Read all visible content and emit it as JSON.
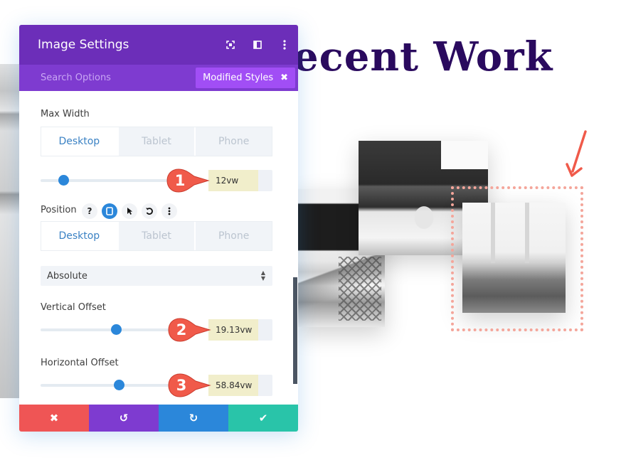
{
  "page": {
    "heading": "ecent Work"
  },
  "panel": {
    "title": "Image Settings",
    "header_icons": [
      "expand-icon",
      "split-view-icon",
      "more-options-icon"
    ],
    "search_placeholder": "Search Options",
    "filter_badge": "Modified Styles",
    "filter_badge_close": "✖",
    "max_width": {
      "label": "Max Width",
      "tabs": [
        "Desktop",
        "Tablet",
        "Phone"
      ],
      "active_tab": "Desktop",
      "value": "12vw",
      "slider_fraction": 0.16,
      "annotation": "1"
    },
    "position": {
      "label": "Position",
      "icons": [
        "help-icon",
        "responsive-icon",
        "hover-cursor-icon",
        "reset-icon",
        "more-options-icon"
      ],
      "help_glyph": "?",
      "tabs": [
        "Desktop",
        "Tablet",
        "Phone"
      ],
      "active_tab": "Desktop",
      "select_value": "Absolute"
    },
    "vertical_offset": {
      "label": "Vertical Offset",
      "value": "19.13vw",
      "slider_fraction": 0.53,
      "annotation": "2"
    },
    "horizontal_offset": {
      "label": "Horizontal Offset",
      "value": "58.84vw",
      "slider_fraction": 0.55,
      "annotation": "3"
    },
    "footer": {
      "cancel": "✖",
      "undo": "↺",
      "redo": "↻",
      "save": "✔"
    }
  },
  "colors": {
    "header_purple": "#6c2eb9",
    "subheader_purple": "#7e3bd0",
    "badge_purple": "#a14ef5",
    "accent_blue": "#2b87da",
    "cancel_red": "#ef5555",
    "save_teal": "#29c4a9",
    "annotation_red": "#f05a4a",
    "dotted_outline": "#f4a59a",
    "heading_color": "#2a0a5e"
  }
}
